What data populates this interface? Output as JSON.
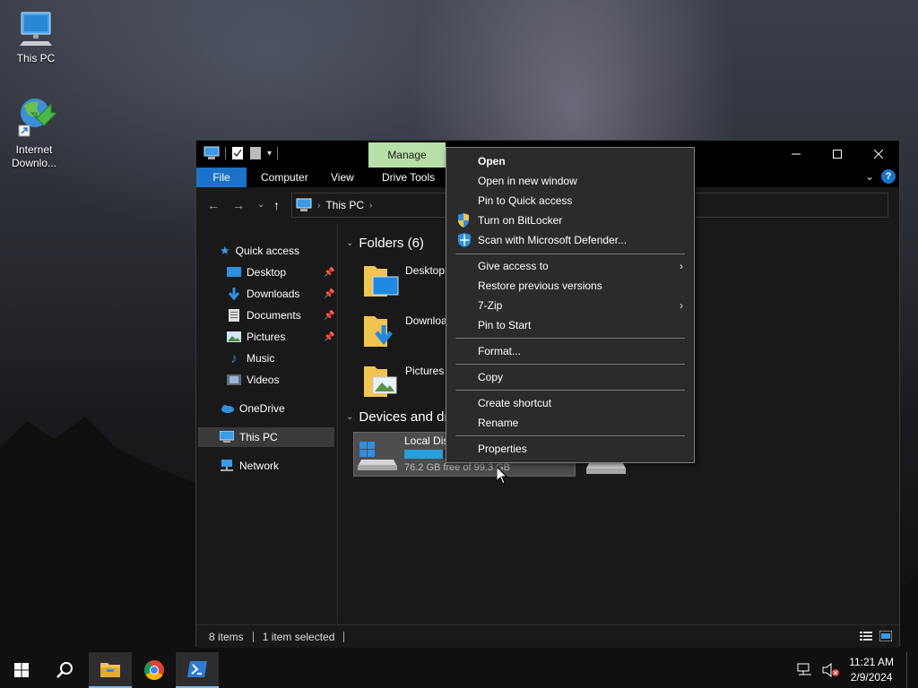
{
  "desktop": {
    "icons": [
      {
        "label": "This PC"
      },
      {
        "label": "Internet Downlo..."
      }
    ]
  },
  "window": {
    "manage_tab": "Manage",
    "ribbon_tabs": [
      "File",
      "Computer",
      "View",
      "Drive Tools"
    ],
    "address": {
      "crumb": "This PC"
    },
    "nav": {
      "quick_access": "Quick access",
      "items": [
        "Desktop",
        "Downloads",
        "Documents",
        "Pictures",
        "Music",
        "Videos"
      ],
      "onedrive": "OneDrive",
      "this_pc": "This PC",
      "network": "Network"
    },
    "content": {
      "folders_header": "Folders (6)",
      "folders": [
        "Desktop",
        "Downloa",
        "Pictures"
      ],
      "devices_header": "Devices and dr",
      "drive": {
        "name": "Local Dis",
        "free": "76.2 GB free of 99.3 GB",
        "used_fraction": 0.23
      }
    },
    "status": {
      "items": "8 items",
      "selected": "1 item selected"
    }
  },
  "context_menu": {
    "items": [
      {
        "label": "Open",
        "bold": true
      },
      {
        "label": "Open in new window"
      },
      {
        "label": "Pin to Quick access"
      },
      {
        "label": "Turn on BitLocker",
        "icon": "shield-icon"
      },
      {
        "label": "Scan with Microsoft Defender...",
        "icon": "defender-icon"
      },
      {
        "label": "Give access to",
        "submenu": true
      },
      {
        "label": "Restore previous versions"
      },
      {
        "label": "7-Zip",
        "submenu": true
      },
      {
        "label": "Pin to Start"
      },
      {
        "label": "Format..."
      },
      {
        "label": "Copy"
      },
      {
        "label": "Create shortcut"
      },
      {
        "label": "Rename"
      },
      {
        "label": "Properties"
      }
    ]
  },
  "taskbar": {
    "clock": {
      "time": "11:21 AM",
      "date": "2/9/2024"
    }
  },
  "colors": {
    "accent": "#1a73c8",
    "manage_tab": "#b7e0a8",
    "drive_bar": "#26a0da"
  }
}
